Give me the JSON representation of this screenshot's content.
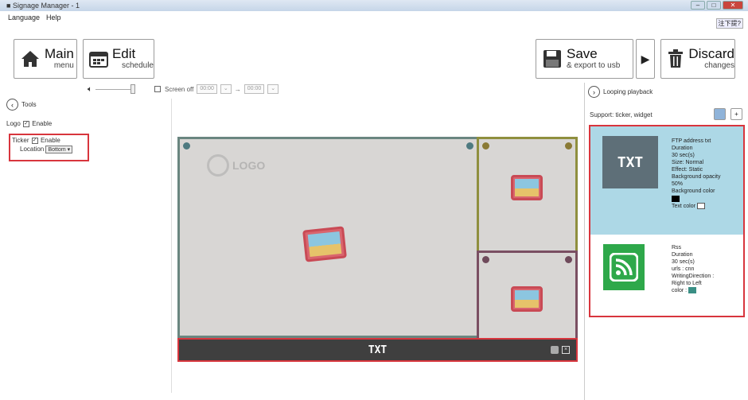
{
  "window": {
    "title": "Signage Manager - 1",
    "ime": "注下提?"
  },
  "menu": {
    "items": [
      "Language",
      "Help"
    ]
  },
  "toolbar": {
    "main": {
      "title": "Main",
      "sub": "menu"
    },
    "edit": {
      "title": "Edit",
      "sub": "schedule"
    },
    "save": {
      "title": "Save",
      "sub": "& export to usb"
    },
    "discard": {
      "title": "Discard",
      "sub": "changes"
    }
  },
  "controls": {
    "screen_off": "Screen off",
    "time_start": "00:00",
    "time_end": "00:00",
    "arrow": "→"
  },
  "tools": {
    "title": "Tools",
    "logo_label": "Logo",
    "logo_enable": "Enable",
    "ticker_label": "Ticker",
    "ticker_enable": "Enable",
    "location_label": "Location",
    "location_value": "Bottom"
  },
  "preview": {
    "logo_text": "LOGO",
    "ticker_text": "TXT"
  },
  "playback": {
    "title": "Looping playback",
    "support": "Support: ticker, widget",
    "items": [
      {
        "thumb": "TXT",
        "name": "FTP address txt",
        "duration_label": "Duration",
        "duration": "30  sec(s)",
        "size": "Size: Normal",
        "effect": "Effect: Static",
        "bg_opacity_label": "Background opacity",
        "bg_opacity": "50%",
        "bg_color_label": "Background color",
        "text_color_label": "Text color",
        "bg_color": "#000000",
        "text_color": "#ffffff"
      },
      {
        "name": "Rss",
        "duration_label": "Duration",
        "duration": "30  sec(s)",
        "urls": "urls :  cnn",
        "writing_label": "WritingDirection :",
        "writing": "Right to Left",
        "color_label": "color :",
        "color": "#3a8f85"
      }
    ]
  },
  "colors": {
    "highlight": "#d8353d",
    "selected_bg": "#add8e6",
    "thumb_txt": "#5e6f78",
    "thumb_rss": "#2ea84a"
  }
}
